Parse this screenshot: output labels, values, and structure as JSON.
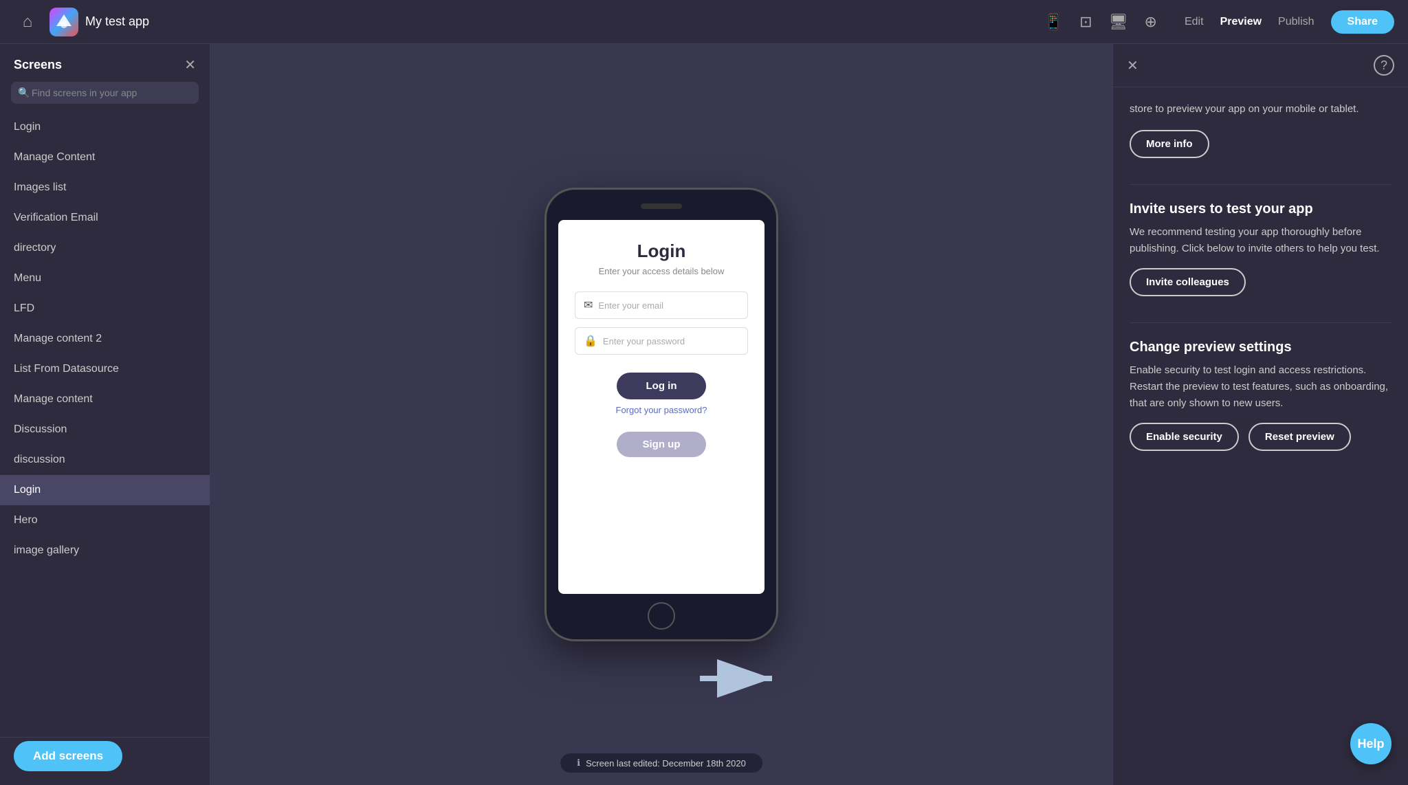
{
  "topnav": {
    "app_title": "My test app",
    "edit_label": "Edit",
    "preview_label": "Preview",
    "publish_label": "Publish",
    "share_label": "Share"
  },
  "sidebar": {
    "title": "Screens",
    "search_placeholder": "Find screens in your app",
    "items": [
      {
        "label": "Login",
        "active": false
      },
      {
        "label": "Manage Content",
        "active": false
      },
      {
        "label": "Images list",
        "active": false
      },
      {
        "label": "Verification Email",
        "active": false
      },
      {
        "label": "directory",
        "active": false
      },
      {
        "label": "Menu",
        "active": false
      },
      {
        "label": "LFD",
        "active": false
      },
      {
        "label": "Manage content 2",
        "active": false
      },
      {
        "label": "List From Datasource",
        "active": false
      },
      {
        "label": "Manage content",
        "active": false
      },
      {
        "label": "Discussion",
        "active": false
      },
      {
        "label": "discussion",
        "active": false
      },
      {
        "label": "Login",
        "active": true
      },
      {
        "label": "Hero",
        "active": false
      },
      {
        "label": "image gallery",
        "active": false
      }
    ],
    "add_screens_label": "Add screens"
  },
  "phone": {
    "login_title": "Login",
    "login_subtitle": "Enter your access details below",
    "email_placeholder": "Enter your email",
    "password_placeholder": "Enter your password",
    "login_btn": "Log in",
    "forgot_label": "Forgot your password?",
    "signup_btn": "Sign up"
  },
  "status_bar": {
    "text": "Screen last edited: December 18th 2020"
  },
  "right_panel": {
    "store_text": "store to preview your app on your mobile or tablet.",
    "more_info_label": "More info",
    "invite_title": "Invite users to test your app",
    "invite_text": "We recommend testing your app thoroughly before publishing. Click below to invite others to help you test.",
    "invite_colleagues_label": "Invite colleagues",
    "settings_title": "Change preview settings",
    "settings_text": "Enable security to test login and access restrictions. Restart the preview to test features, such as onboarding, that are only shown to new users.",
    "enable_security_label": "Enable security",
    "reset_preview_label": "Reset preview",
    "help_label": "Help"
  }
}
